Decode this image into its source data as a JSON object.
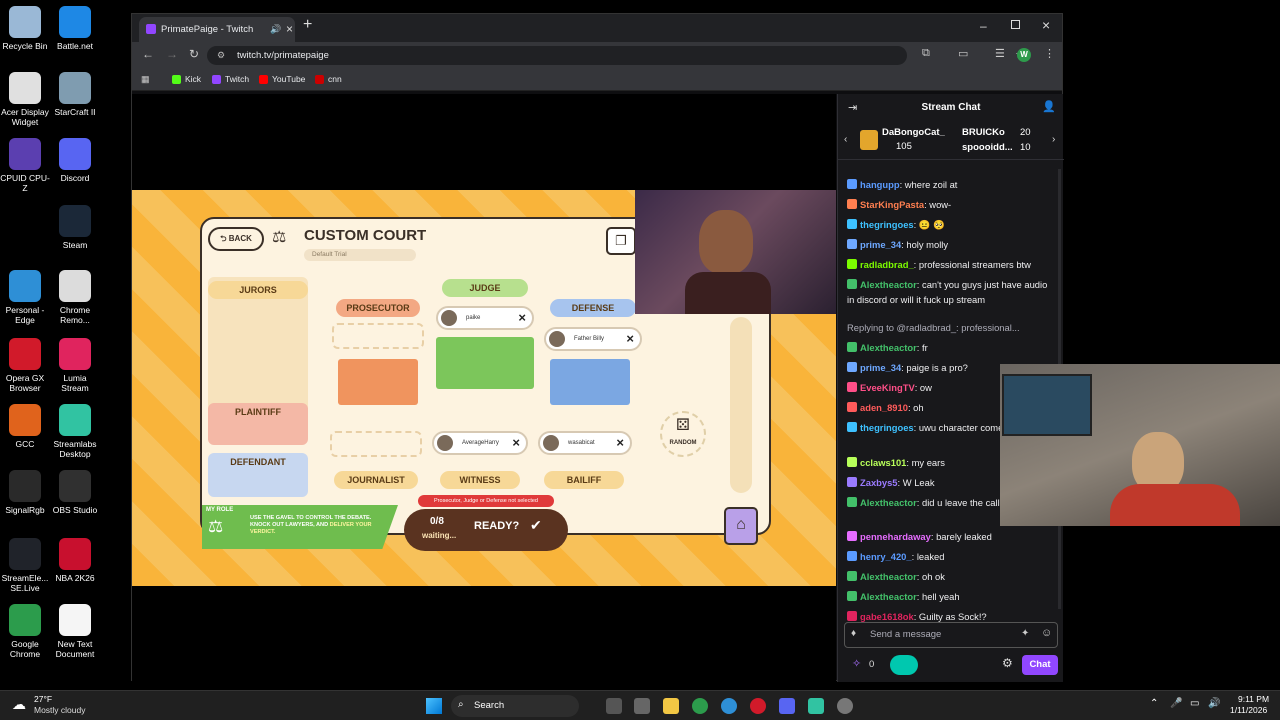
{
  "desktop_icons": [
    {
      "label": "Recycle Bin",
      "color": "#9ab8d6"
    },
    {
      "label": "Battle.net",
      "color": "#1e88e5"
    },
    {
      "label": "Acer Display Widget",
      "color": "#e0e0e0"
    },
    {
      "label": "StarCraft II",
      "color": "#7f9cb0"
    },
    {
      "label": "CPUID CPU-Z",
      "color": "#5b3fb0"
    },
    {
      "label": "Discord",
      "color": "#5865f2"
    },
    {
      "label": "Steam",
      "color": "#1b2838"
    },
    {
      "label": "Personal - Edge",
      "color": "#2e8fd6"
    },
    {
      "label": "Chrome Remo...",
      "color": "#dcdcdc"
    },
    {
      "label": "Opera GX Browser",
      "color": "#d11a2a"
    },
    {
      "label": "Lumia Stream",
      "color": "#e0245e"
    },
    {
      "label": "GCC",
      "color": "#e0631c"
    },
    {
      "label": "Streamlabs Desktop",
      "color": "#31c3a2"
    },
    {
      "label": "SignalRgb",
      "color": "#2a2a2a"
    },
    {
      "label": "OBS Studio",
      "color": "#303030"
    },
    {
      "label": "StreamEle... SE.Live",
      "color": "#20232a"
    },
    {
      "label": "NBA 2K26",
      "color": "#c8102e"
    },
    {
      "label": "Google Chrome",
      "color": "#2c9c4c"
    },
    {
      "label": "New Text Document",
      "color": "#f5f5f5"
    }
  ],
  "browser": {
    "tab_title": "PrimatePaige - Twitch",
    "url": "twitch.tv/primatepaige",
    "profile_initial": "W",
    "bookmarks": [
      {
        "label": "Kick",
        "color": "#53fc18"
      },
      {
        "label": "Twitch",
        "color": "#9146ff"
      },
      {
        "label": "YouTube",
        "color": "#ff0000"
      },
      {
        "label": "cnn",
        "color": "#cc0000"
      }
    ]
  },
  "game": {
    "back": "BACK",
    "title": "CUSTOM COURT",
    "subtitle": "Default Trial",
    "jurors": "JURORS",
    "prosecutor": "PROSECUTOR",
    "judge": "JUDGE",
    "defense": "DEFENSE",
    "plaintiff": "PLAINTIFF",
    "defendant": "DEFENDANT",
    "journalist": "JOURNALIST",
    "witness": "WITNESS",
    "bailiff": "BAILIFF",
    "random": "RANDOM",
    "judge_player": "paike",
    "defense_player": "Father Billy",
    "witness_player": "AverageHarry",
    "bailiff_player": "wasabicat",
    "my_role": "MY ROLE",
    "role_text_1": "USE THE GAVEL TO CONTROL THE DEBATE.",
    "role_text_2": "KNOCK OUT LAWYERS, AND",
    "role_text_3": "DELIVER",
    "role_text_4": "YOUR VERDICT.",
    "warning": "Prosecutor, Judge or Defense not selected",
    "ready_count": "0/8",
    "waiting": "waiting...",
    "ready": "READY?"
  },
  "chat": {
    "title": "Stream Chat",
    "gifters": [
      {
        "name": "DaBongoCat_",
        "count": "105"
      },
      {
        "name": "BRUICKo",
        "count": "20"
      },
      {
        "name": "spoooidd...",
        "count": "10"
      }
    ],
    "messages": [
      {
        "user": "hangupp",
        "text": ": where zoil at",
        "color": "#5b9bff"
      },
      {
        "user": "StarKingPasta",
        "text": ": wow-",
        "color": "#ff7f50"
      },
      {
        "user": "thegringoes",
        "text": ": 😐 🥺",
        "color": "#3ec1ff"
      },
      {
        "user": "prime_34",
        "text": ": holy molly",
        "color": "#6ea8ff"
      },
      {
        "user": "radladbrad_",
        "text": ": professional streamers btw",
        "color": "#7cfc00"
      },
      {
        "user": "Alextheactor",
        "text": ": can't you guys just have audio in discord or will it fuck up stream",
        "color": "#43c06a"
      },
      {
        "user": "",
        "text": "Replying to @radladbrad_: professional...",
        "color": "#adadb8",
        "reply": true
      },
      {
        "user": "Alextheactor",
        "text": ": fr",
        "color": "#43c06a"
      },
      {
        "user": "prime_34",
        "text": ": paige is a pro?",
        "color": "#6ea8ff"
      },
      {
        "user": "EveeKingTV",
        "text": ": ow",
        "color": "#ff4f88"
      },
      {
        "user": "aden_8910",
        "text": ": oh",
        "color": "#ff5b5b"
      },
      {
        "user": "thegringoes",
        "text": ": uwu character comeback",
        "color": "#3ec1ff"
      },
      {
        "user": "cclaws101",
        "text": ": my ears",
        "color": "#b8ff5a"
      },
      {
        "user": "Zaxbys5",
        "text": ": W Leak",
        "color": "#9b7bff"
      },
      {
        "user": "Alextheactor",
        "text": ": did u leave the call or smth",
        "color": "#43c06a"
      },
      {
        "user": "pennehardaway",
        "text": ": barely leaked",
        "color": "#e66dff"
      },
      {
        "user": "henry_420_",
        "text": ": leaked",
        "color": "#5b9bff"
      },
      {
        "user": "Alextheactor",
        "text": ": oh ok",
        "color": "#43c06a"
      },
      {
        "user": "Alextheactor",
        "text": ": hell yeah",
        "color": "#43c06a"
      },
      {
        "user": "gabe1618ok",
        "text": ": Guilty as Sock!?",
        "color": "#e0245e"
      }
    ],
    "input_placeholder": "Send a message",
    "points": "0",
    "chat_button": "Chat"
  },
  "taskbar": {
    "temperature": "27°F",
    "weather": "Mostly cloudy",
    "search": "Search",
    "time": "9:11 PM",
    "date": "1/11/2026"
  }
}
